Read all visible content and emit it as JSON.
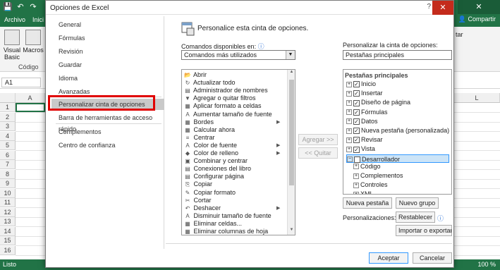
{
  "excel": {
    "ribbon_tabs": [
      "Archivo",
      "Inici"
    ],
    "share_label": "Compartir",
    "ribbon_buttons": [
      {
        "label": "Visual Basic"
      },
      {
        "label": "Macros"
      }
    ],
    "group_label": "Código",
    "right_group_label": "tar",
    "name_box": "A1",
    "columns": [
      "A",
      "L"
    ],
    "rows": [
      "1",
      "2",
      "3",
      "4",
      "5",
      "6",
      "7",
      "8",
      "9",
      "10",
      "11",
      "12",
      "13",
      "14",
      "15",
      "16"
    ],
    "status": "Listo",
    "zoom": "100 %",
    "accent_color": "#217346"
  },
  "dialog": {
    "title": "Opciones de Excel",
    "help_icon": "question-icon",
    "close_icon": "close-icon",
    "nav": [
      "General",
      "Fórmulas",
      "Revisión",
      "Guardar",
      "Idioma",
      "Avanzadas",
      "Personalizar cinta de opciones",
      "Barra de herramientas de acceso rápido",
      "Complementos",
      "Centro de confianza"
    ],
    "selected_nav": "Personalizar cinta de opciones",
    "headline": "Personalice esta cinta de opciones.",
    "commands_label": "Comandos disponibles en:",
    "commands_value": "Comandos más utilizados",
    "ribbon_label": "Personalizar la cinta de opciones:",
    "ribbon_value": "Pestañas principales",
    "commands": [
      "Abrir",
      "Actualizar todo",
      "Administrador de nombres",
      "Agregar o quitar filtros",
      "Aplicar formato a celdas",
      "Aumentar tamaño de fuente",
      "Bordes",
      "Calcular ahora",
      "Centrar",
      "Color de fuente",
      "Color de relleno",
      "Combinar y centrar",
      "Conexiones del libro",
      "Configurar página",
      "Copiar",
      "Copiar formato",
      "Cortar",
      "Deshacer",
      "Disminuir tamaño de fuente",
      "Eliminar celdas...",
      "Eliminar columnas de hoja"
    ],
    "add_button": "Agregar >>",
    "remove_button": "<< Quitar",
    "tree_header": "Pestañas principales",
    "tree": [
      "Inicio",
      "Insertar",
      "Diseño de página",
      "Fórmulas",
      "Datos",
      "Nueva pestaña (personalizada)",
      "Revisar",
      "Vista",
      "Desarrollador"
    ],
    "tree_children": [
      "Código",
      "Complementos",
      "Controles",
      "XML"
    ],
    "new_tab_button": "Nueva pestaña",
    "new_group_button": "Nuevo grupo",
    "customizations_label": "Personalizaciones:",
    "reset_button": "Restablecer ▾",
    "import_export_button": "Importar o exportar ▾",
    "ok_button": "Aceptar",
    "cancel_button": "Cancelar",
    "selection_color": "#cce4f7",
    "highlight_color": "#e00000"
  }
}
